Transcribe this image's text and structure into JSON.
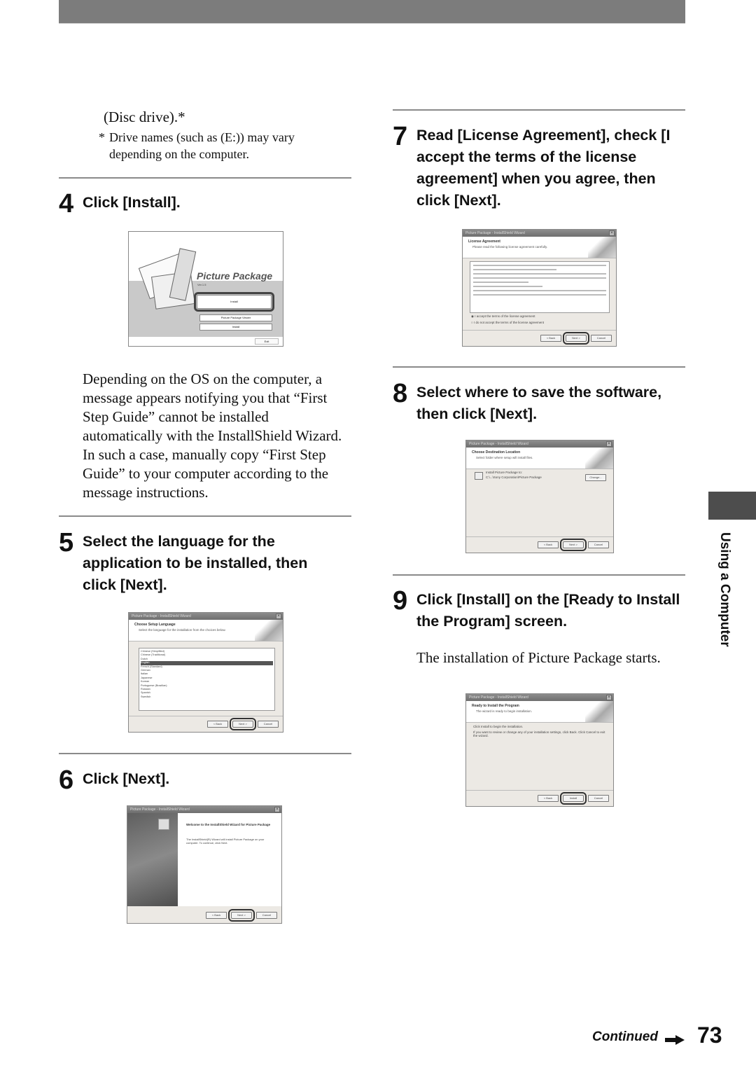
{
  "header_bar": {
    "color": "#7c7c7c"
  },
  "intro": {
    "text": "(Disc drive).*",
    "footnote_mark": "*",
    "footnote": "Drive names (such as (E:)) may vary depending on the computer."
  },
  "steps": [
    {
      "number": "4",
      "title": "Click [Install].",
      "body": "Depending on the OS on the computer, a message appears notifying you that “First Step Guide” cannot be installed automatically with the InstallShield Wizard. In such a case, manually copy “First Step Guide” to your computer according to the message instructions.",
      "screenshot": {
        "app_title": "Picture Package",
        "version": "Ver.1.5",
        "buttons": [
          "Install",
          "Picture Package Viewer",
          "Install",
          "Exit"
        ],
        "highlighted": "Install"
      }
    },
    {
      "number": "5",
      "title": "Select the language for the application to be installed, then click [Next].",
      "screenshot": {
        "window_title": "Picture Package - InstallShield Wizard",
        "heading": "Choose Setup Language",
        "subheading": "Select the language for the installation from the choices below.",
        "languages": [
          "Chinese (Simplified)",
          "Chinese (Traditional)",
          "Dutch",
          "English",
          "French (Standard)",
          "German",
          "Italian",
          "Japanese",
          "Korean",
          "Portuguese (Brazilian)",
          "Russian",
          "Spanish",
          "Swedish"
        ],
        "selected_language": "English",
        "buttons": [
          "< Back",
          "Next >",
          "Cancel"
        ],
        "highlighted": "Next >"
      }
    },
    {
      "number": "6",
      "title": "Click [Next].",
      "screenshot": {
        "window_title": "Picture Package - InstallShield Wizard",
        "heading": "Welcome to the InstallShield Wizard for Picture Package",
        "text": "The InstallShield(R) Wizard will install Picture Package on your computer. To continue, click Next.",
        "buttons": [
          "< Back",
          "Next >",
          "Cancel"
        ],
        "highlighted": "Next >"
      }
    },
    {
      "number": "7",
      "title": "Read [License Agreement], check [I accept the terms of the license agreement] when you agree, then click [Next].",
      "screenshot": {
        "window_title": "Picture Package - InstallShield Wizard",
        "heading": "License Agreement",
        "subheading": "Please read the following license agreement carefully.",
        "options": [
          "I accept the terms of the license agreement",
          "I do not accept the terms of the license agreement"
        ],
        "selected_option": "I accept the terms of the license agreement",
        "buttons": [
          "< Back",
          "Next >",
          "Cancel"
        ],
        "highlighted": "Next >"
      }
    },
    {
      "number": "8",
      "title": "Select where to save the software, then click [Next].",
      "screenshot": {
        "window_title": "Picture Package - InstallShield Wizard",
        "heading": "Choose Destination Location",
        "subheading": "Select folder where setup will install files.",
        "install_label": "Install Picture Package to:",
        "path": "C:\\...\\Sony Corporation\\Picture Package",
        "change_button": "Change...",
        "buttons": [
          "< Back",
          "Next >",
          "Cancel"
        ],
        "highlighted": "Next >"
      }
    },
    {
      "number": "9",
      "title": "Click [Install] on the [Ready to Install the Program] screen.",
      "body": "The installation of Picture Package starts.",
      "screenshot": {
        "window_title": "Picture Package - InstallShield Wizard",
        "heading": "Ready to Install the Program",
        "subheading": "The wizard is ready to begin installation.",
        "line1": "Click Install to begin the installation.",
        "line2": "If you want to review or change any of your installation settings, click Back. Click Cancel to exit the wizard.",
        "buttons": [
          "< Back",
          "Install",
          "Cancel"
        ],
        "highlighted": "Install"
      }
    }
  ],
  "side_tab": {
    "label": "Using a Computer",
    "color": "#4d4d4d"
  },
  "footer": {
    "continued": "Continued",
    "page_number": "73"
  }
}
